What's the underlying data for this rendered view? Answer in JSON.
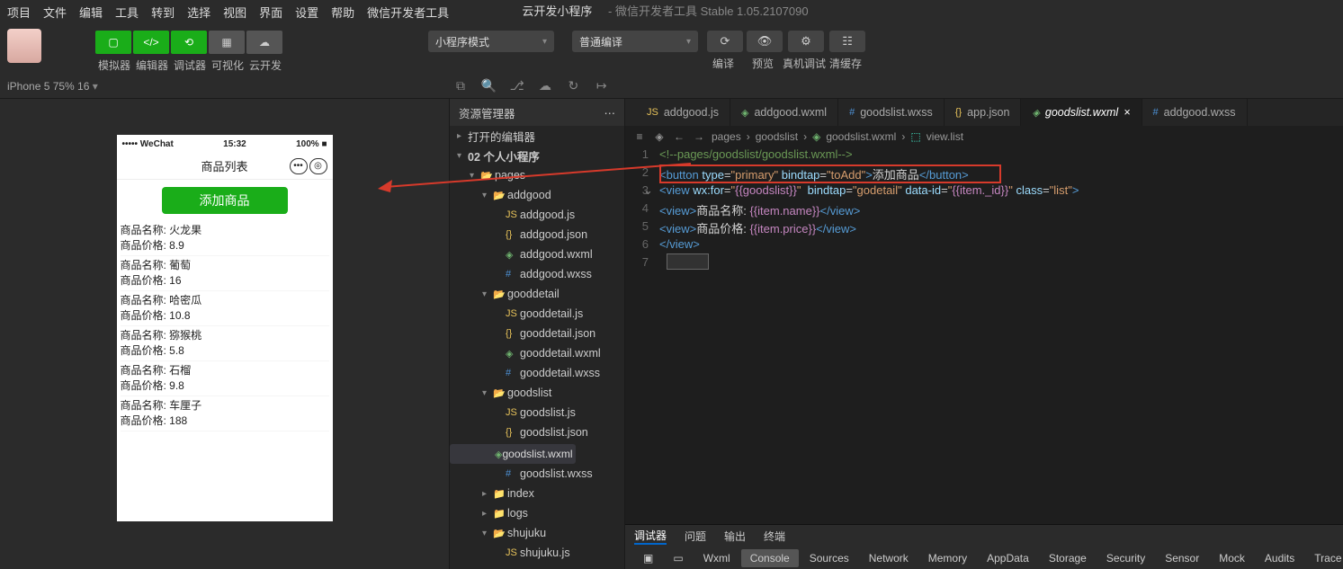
{
  "menu": [
    "项目",
    "文件",
    "编辑",
    "工具",
    "转到",
    "选择",
    "视图",
    "界面",
    "设置",
    "帮助",
    "微信开发者工具"
  ],
  "title": {
    "t1": "云开发小程序",
    "t2": " - 微信开发者工具 Stable 1.05.2107090"
  },
  "toolbar": {
    "groupLabels": [
      "模拟器",
      "编辑器",
      "调试器",
      "可视化",
      "云开发"
    ],
    "mode": {
      "label": "小程序模式"
    },
    "compile": {
      "label": "普通编译"
    },
    "right": [
      "编译",
      "预览",
      "真机调试",
      "清缓存"
    ]
  },
  "devbar": {
    "device": "iPhone 5 75% 16"
  },
  "phone": {
    "status": {
      "left": "••••• WeChat",
      "time": "15:32",
      "right": "100%"
    },
    "title": "商品列表",
    "button": "添加商品",
    "labels": {
      "name": "商品名称:",
      "price": "商品价格:"
    },
    "goods": [
      {
        "name": "火龙果",
        "price": "8.9"
      },
      {
        "name": "葡萄",
        "price": "16"
      },
      {
        "name": "哈密瓜",
        "price": "10.8"
      },
      {
        "name": "猕猴桃",
        "price": "5.8"
      },
      {
        "name": "石榴",
        "price": "9.8"
      },
      {
        "name": "车厘子",
        "price": "188"
      }
    ]
  },
  "explorer": {
    "header": "资源管理器",
    "row1": "打开的编辑器",
    "row2": "02 个人小程序",
    "tree": [
      {
        "d": 1,
        "t": "folder",
        "open": 1,
        "label": "pages",
        "ico": "📁"
      },
      {
        "d": 2,
        "t": "folder",
        "open": 1,
        "label": "addgood",
        "ico": "📂"
      },
      {
        "d": 3,
        "t": "js",
        "label": "addgood.js"
      },
      {
        "d": 3,
        "t": "json",
        "label": "addgood.json"
      },
      {
        "d": 3,
        "t": "wxml",
        "label": "addgood.wxml"
      },
      {
        "d": 3,
        "t": "wxss",
        "label": "addgood.wxss"
      },
      {
        "d": 2,
        "t": "folder",
        "open": 1,
        "label": "gooddetail",
        "ico": "📂"
      },
      {
        "d": 3,
        "t": "js",
        "label": "gooddetail.js"
      },
      {
        "d": 3,
        "t": "json",
        "label": "gooddetail.json"
      },
      {
        "d": 3,
        "t": "wxml",
        "label": "gooddetail.wxml"
      },
      {
        "d": 3,
        "t": "wxss",
        "label": "gooddetail.wxss"
      },
      {
        "d": 2,
        "t": "folder",
        "open": 1,
        "label": "goodslist",
        "ico": "📂"
      },
      {
        "d": 3,
        "t": "js",
        "label": "goodslist.js"
      },
      {
        "d": 3,
        "t": "json",
        "label": "goodslist.json"
      },
      {
        "d": 3,
        "t": "wxml",
        "label": "goodslist.wxml",
        "sel": 1
      },
      {
        "d": 3,
        "t": "wxss",
        "label": "goodslist.wxss"
      },
      {
        "d": 2,
        "t": "folder",
        "open": 0,
        "label": "index",
        "ico": "📁"
      },
      {
        "d": 2,
        "t": "folder",
        "open": 0,
        "label": "logs",
        "ico": "📁"
      },
      {
        "d": 2,
        "t": "folder",
        "open": 1,
        "label": "shujuku",
        "ico": "📂"
      },
      {
        "d": 3,
        "t": "js",
        "label": "shujuku.js"
      }
    ]
  },
  "tabs": [
    {
      "ico": "JS",
      "cls": "i-js",
      "label": "addgood.js"
    },
    {
      "ico": "◈",
      "cls": "i-wxml",
      "label": "addgood.wxml"
    },
    {
      "ico": "#",
      "cls": "i-wxss",
      "label": "goodslist.wxss"
    },
    {
      "ico": "{}",
      "cls": "i-json",
      "label": "app.json"
    },
    {
      "ico": "◈",
      "cls": "i-wxml",
      "label": "goodslist.wxml",
      "active": 1,
      "close": 1
    },
    {
      "ico": "#",
      "cls": "i-wxss",
      "label": "addgood.wxss"
    }
  ],
  "crumb": {
    "p1": "pages",
    "p2": "goodslist",
    "p3": "goodslist.wxml",
    "p4": "view.list"
  },
  "code": {
    "l1": "<!--pages/goodslist/goodslist.wxml-->",
    "l2": {
      "btn": "添加商品"
    },
    "l3": {
      "attr": "{{goodslist}}",
      "bind": "godetail",
      "id": "{{item._id}}",
      "cls": "list"
    },
    "l4": {
      "lbl": "商品名称:",
      "mus": "{{item.name}}"
    },
    "l5": {
      "lbl": "商品价格:",
      "mus": "{{item.price}}"
    }
  },
  "bottomTabs": [
    "调试器",
    "问题",
    "输出",
    "终端"
  ],
  "devtools": [
    "Wxml",
    "Console",
    "Sources",
    "Network",
    "Memory",
    "AppData",
    "Storage",
    "Security",
    "Sensor",
    "Mock",
    "Audits",
    "Trace"
  ]
}
